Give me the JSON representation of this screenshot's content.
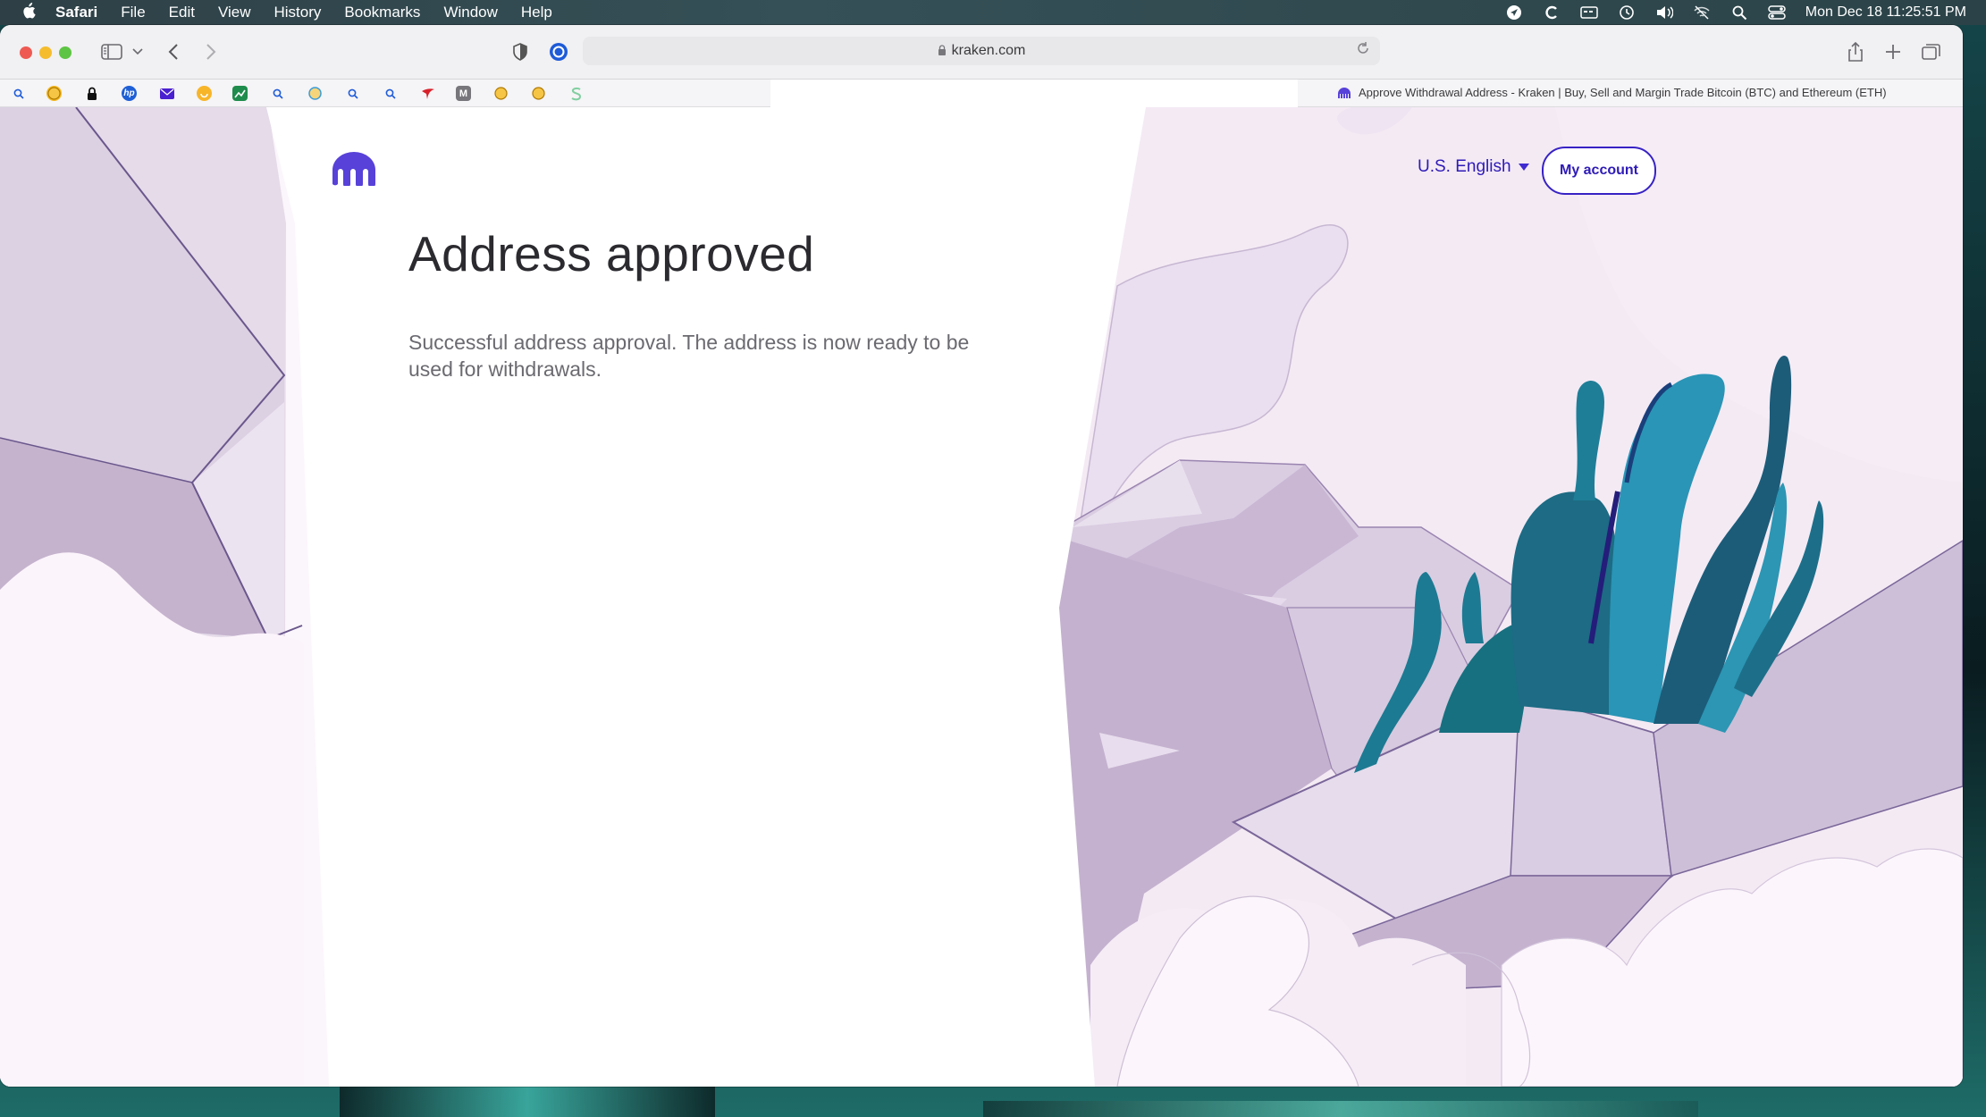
{
  "menubar": {
    "app": "Safari",
    "items": [
      "File",
      "Edit",
      "View",
      "History",
      "Bookmarks",
      "Window",
      "Help"
    ],
    "clock": "Mon Dec 18  11:25:51 PM"
  },
  "browser": {
    "url": "kraken.com",
    "tab_title": "Approve Withdrawal Address - Kraken | Buy, Sell and Margin Trade Bitcoin (BTC) and Ethereum (ETH)"
  },
  "page": {
    "language": "U.S. English",
    "account_button": "My account",
    "heading": "Address approved",
    "message": "Successful address approval. The address is now ready to be used for withdrawals."
  },
  "colors": {
    "brand": "#5741d9",
    "button_border": "#3722c4"
  }
}
